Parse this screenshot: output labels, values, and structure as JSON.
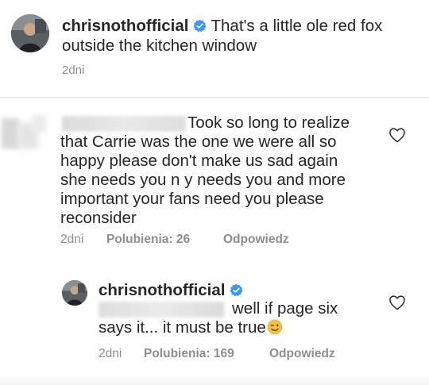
{
  "caption": {
    "username": "chrisnothofficial",
    "text": " That's a little ole red fox outside the kitchen window",
    "time": "2dni"
  },
  "comment": {
    "text_line1": "Took so long to realize",
    "text_rest": "that Carrie was the one we were all so happy please don't make us sad again she needs you n y needs you and more important your fans need you please reconsider",
    "time": "2dni",
    "likes": "Polubienia: 26",
    "reply_label": "Odpowiedz"
  },
  "reply": {
    "username": "chrisnothofficial",
    "text_line1": "well if page six",
    "text_rest": "says it... it must be true",
    "time": "2dni",
    "likes": "Polubienia: 169",
    "reply_label": "Odpowiedz"
  },
  "icons": {
    "verified": "verified-badge-icon",
    "heart": "heart-outline-icon",
    "emoji": "winking-smile-emoji"
  },
  "colors": {
    "text": "#262626",
    "meta": "#8e8e8e",
    "verified_blue": "#3897f0",
    "emoji_yellow": "#f7c33c"
  }
}
